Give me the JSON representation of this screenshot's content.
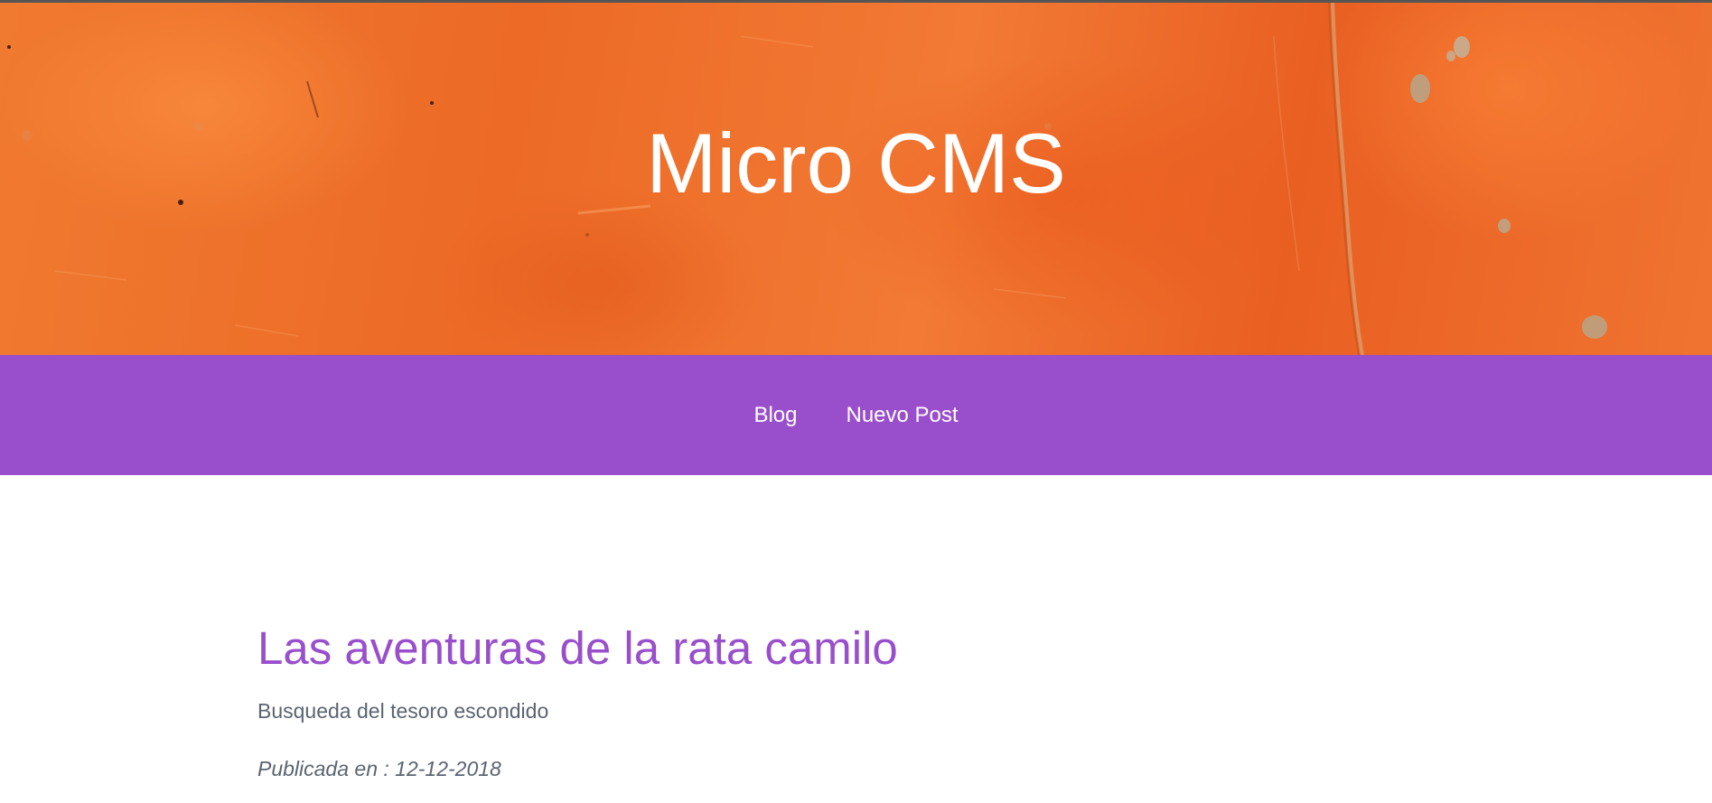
{
  "site": {
    "title": "Micro CMS"
  },
  "nav": {
    "items": [
      {
        "label": "Blog"
      },
      {
        "label": "Nuevo Post"
      }
    ]
  },
  "post": {
    "title": "Las aventuras de la rata camilo",
    "subtitle": "Busqueda del tesoro escondido",
    "published_label": "Publicada en :",
    "published_date": "12-12-2018",
    "published_text": "Publicada en : 12-12-2018"
  },
  "colors": {
    "hero_orange": "#ec6a26",
    "nav_purple": "#994fcc",
    "title_purple": "#994fcc",
    "body_text": "#5a6470"
  }
}
